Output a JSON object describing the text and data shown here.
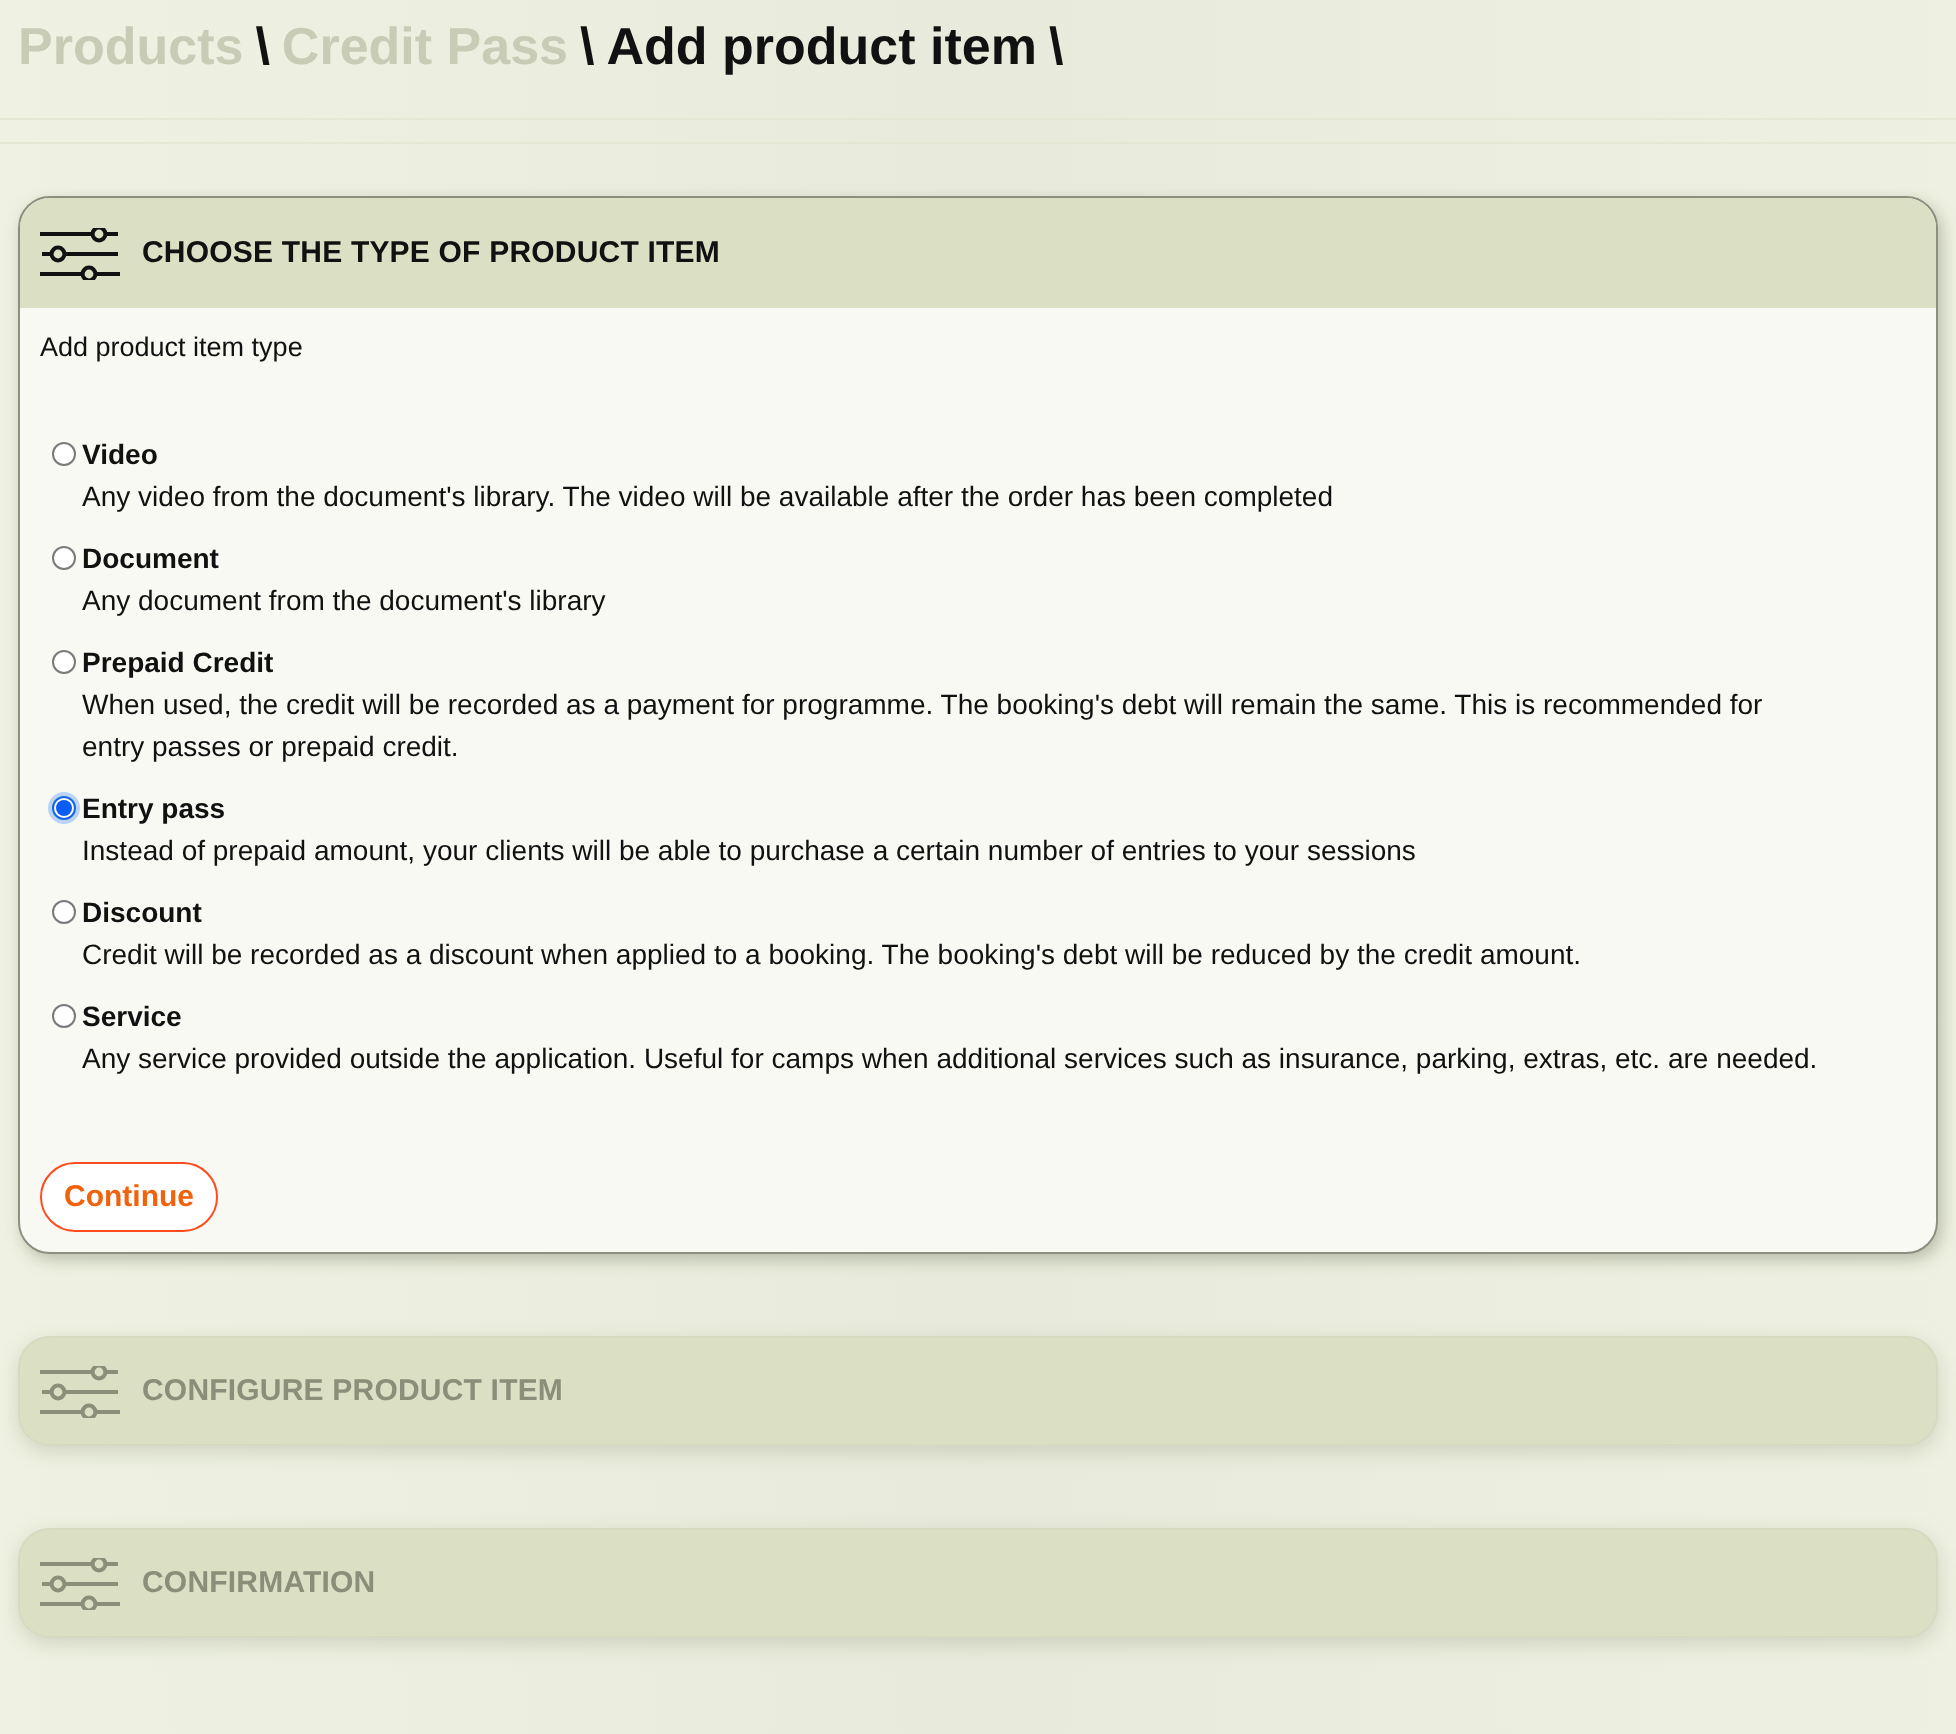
{
  "breadcrumb": [
    {
      "label": "Products",
      "separator": "\\",
      "current": false
    },
    {
      "label": "Credit Pass",
      "separator": "\\",
      "current": false
    },
    {
      "label": "Add product item",
      "separator": "\\",
      "current": true
    }
  ],
  "steps": [
    {
      "title": "CHOOSE THE TYPE OF PRODUCT ITEM",
      "expanded": true,
      "prompt": "Add product item type",
      "options": [
        {
          "label": "Video",
          "description": "Any video from the document's library. The video will be available after the order has been completed",
          "selected": false
        },
        {
          "label": "Document",
          "description": "Any document from the document's library",
          "selected": false
        },
        {
          "label": "Prepaid Credit",
          "description": "When used, the credit will be recorded as a payment for programme. The booking's debt will remain the same. This is recommended for entry passes or prepaid credit.",
          "selected": false
        },
        {
          "label": "Entry pass",
          "description": "Instead of prepaid amount, your clients will be able to purchase a certain number of entries to your sessions",
          "selected": true
        },
        {
          "label": "Discount",
          "description": "Credit will be recorded as a discount when applied to a booking. The booking's debt will be reduced by the credit amount.",
          "selected": false
        },
        {
          "label": "Service",
          "description": "Any service provided outside the application. Useful for camps when additional services such as insurance, parking, extras, etc. are needed.",
          "selected": false
        }
      ],
      "button": "Continue"
    },
    {
      "title": "CONFIGURE PRODUCT ITEM",
      "expanded": false
    },
    {
      "title": "CONFIRMATION",
      "expanded": false
    }
  ]
}
